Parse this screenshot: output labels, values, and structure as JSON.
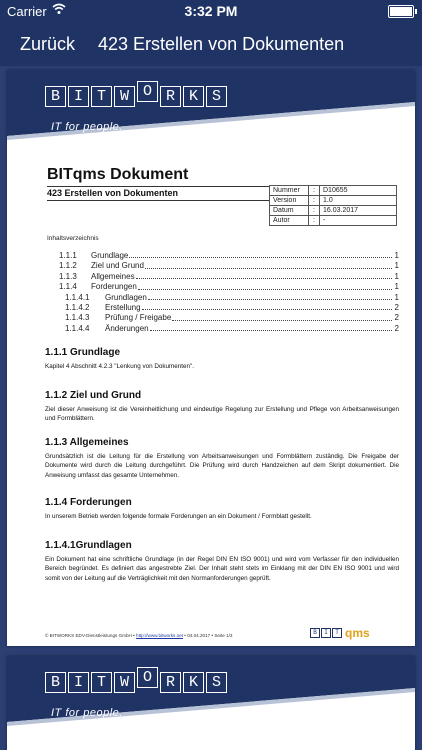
{
  "status_bar": {
    "carrier": "Carrier",
    "time": "3:32 PM"
  },
  "nav": {
    "back_label": "Zurück",
    "title": "423 Erstellen von Dokumenten"
  },
  "banner": {
    "logo_letters": [
      "B",
      "I",
      "T",
      "W",
      "O",
      "R",
      "K",
      "S"
    ],
    "tagline": "IT for people."
  },
  "document": {
    "title": "BITqms Dokument",
    "subtitle": "423 Erstellen von Dokumenten",
    "meta": [
      {
        "key": "Nummer",
        "sep": ":",
        "value": "D10655"
      },
      {
        "key": "Version",
        "sep": ":",
        "value": "1.0"
      },
      {
        "key": "Datum",
        "sep": ":",
        "value": "16.03.2017"
      },
      {
        "key": "Autor",
        "sep": ":",
        "value": "-"
      }
    ],
    "toc_heading": "Inhaltsverzeichnis",
    "toc": [
      {
        "num": "1.1.1",
        "text": "Grundlage",
        "page": "1"
      },
      {
        "num": "1.1.2",
        "text": "Ziel und Grund",
        "page": "1"
      },
      {
        "num": "1.1.3",
        "text": "Allgemeines",
        "page": "1"
      },
      {
        "num": "1.1.4",
        "text": "Forderungen",
        "page": "1"
      },
      {
        "num": "1.1.4.1",
        "text": "Grundlagen",
        "page": "1"
      },
      {
        "num": "1.1.4.2",
        "text": "Erstellung",
        "page": "2"
      },
      {
        "num": "1.1.4.3",
        "text": "Prüfung / Freigabe",
        "page": "2"
      },
      {
        "num": "1.1.4.4",
        "text": "Änderungen",
        "page": "2"
      }
    ],
    "sections": [
      {
        "heading": "1.1.1 Grundlage",
        "text": "Kapitel 4 Abschnitt 4.2.3 \"Lenkung von Dokumenten\"."
      },
      {
        "heading": "1.1.2 Ziel und Grund",
        "text": "Ziel dieser Anweisung ist die Vereinheitlichung und eindeutige Regelung zur Erstellung und Pflege von Arbeitsanweisungen und Formblättern."
      },
      {
        "heading": "1.1.3 Allgemeines",
        "text": "Grundsätzlich ist die Leitung für die Erstellung von Arbeitsanweisungen und Formblättern zuständig. Die Freigabe der Dokumente wird durch die Leitung durchgeführt. Die Prüfung wird durch Handzeichen auf dem Skript dokumentiert. Die Anweisung umfasst das gesamte Unternehmen."
      },
      {
        "heading": "1.1.4 Forderungen",
        "text": "In unserem Betrieb werden folgende formale Forderungen an ein Dokument / Formblatt gestellt."
      },
      {
        "heading": "1.1.4.1Grundlagen",
        "text": "Ein Dokument hat eine schriftliche Grundlage (in der Regel DIN EN ISO 9001) und wird vom Verfasser für den individuellen Bereich begründet. Es definiert das angestrebte Ziel. Der Inhalt steht stets im Einklang mit der DIN EN ISO 9001 und wird somit von der Leitung auf die Verträglichkeit mit den Normanforderungen geprüft."
      }
    ],
    "footer": {
      "company": "© BITWORKS EDV-Dienstleistungs GmbH",
      "sep1": " • ",
      "url": "http://www.bitworks.net",
      "sep2": " • ",
      "date": "04.04.2017",
      "sep3": " • ",
      "page": "Seite 1/3",
      "logo_boxes": [
        "B",
        "I",
        "T"
      ],
      "logo_suffix": "qms"
    }
  },
  "colors": {
    "navy": "#1f3364",
    "viewer_bg": "#2b3f73",
    "accent_gold": "#e0a11b"
  }
}
